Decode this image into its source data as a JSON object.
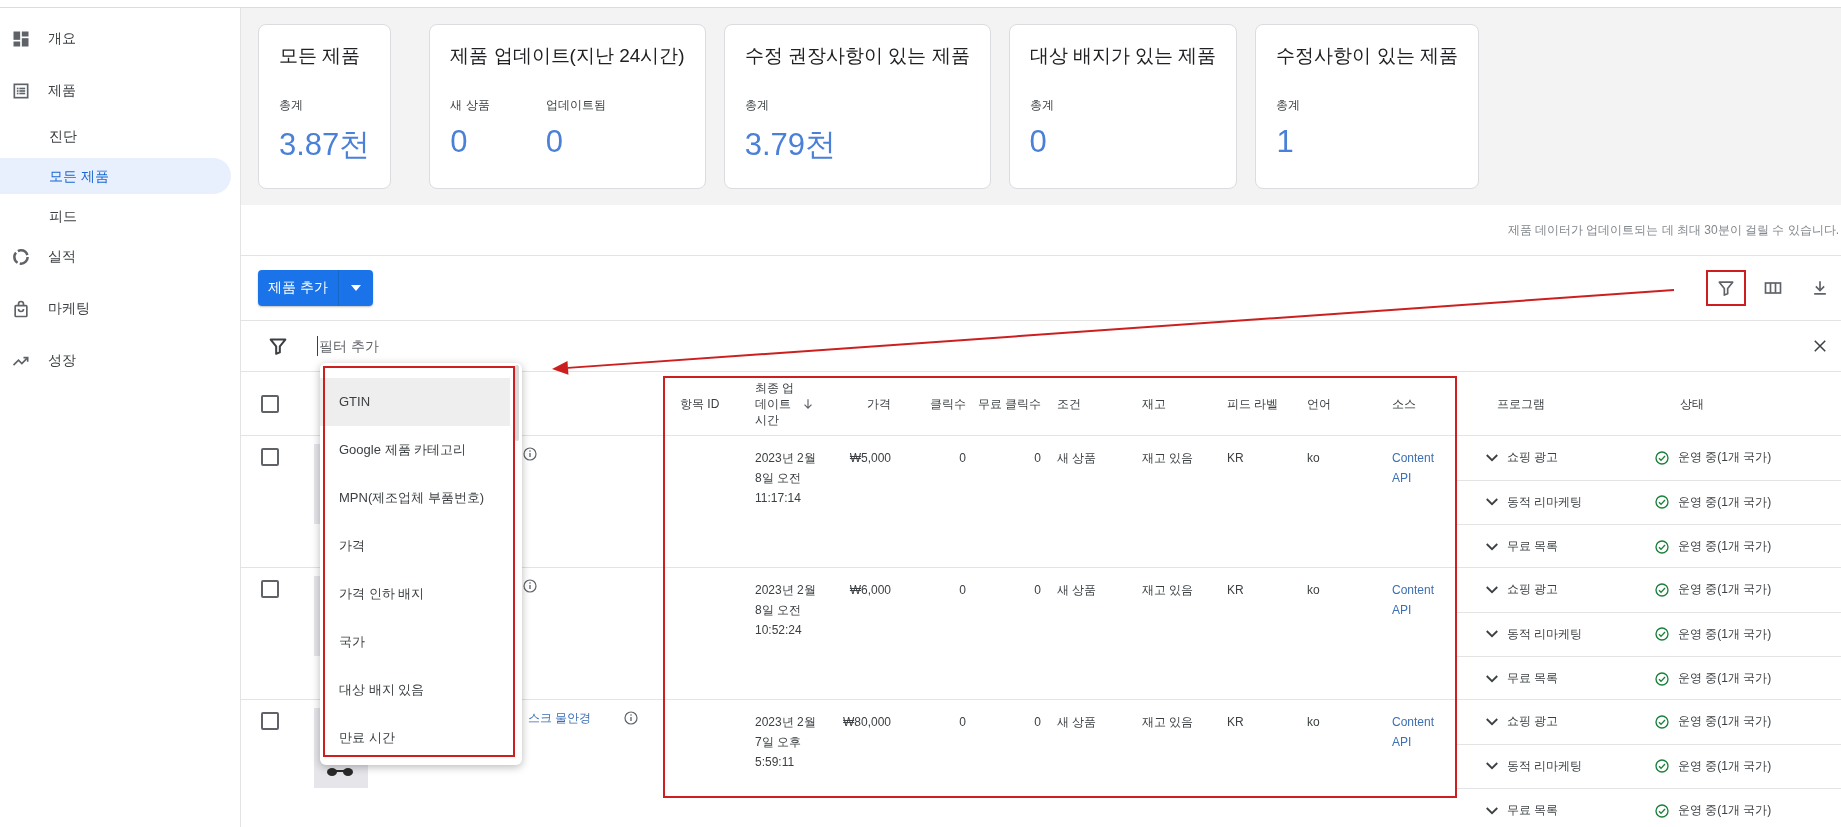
{
  "sidebar": {
    "items": [
      {
        "label": "개요",
        "selected": false
      },
      {
        "label": "제품",
        "selected": false,
        "children": [
          {
            "label": "진단",
            "selected": false
          },
          {
            "label": "모든 제품",
            "selected": true
          },
          {
            "label": "피드",
            "selected": false
          }
        ]
      },
      {
        "label": "실적",
        "selected": false
      },
      {
        "label": "마케팅",
        "selected": false
      },
      {
        "label": "성장",
        "selected": false
      }
    ]
  },
  "summary_cards": [
    {
      "title": "모든 제품",
      "metrics": [
        {
          "label": "총계",
          "value": "3.87천"
        }
      ]
    },
    {
      "title": "제품 업데이트(지난 24시간)",
      "metrics": [
        {
          "label": "새 상품",
          "value": "0"
        },
        {
          "label": "업데이트됨",
          "value": "0"
        }
      ]
    },
    {
      "title": "수정 권장사항이 있는 제품",
      "metrics": [
        {
          "label": "총계",
          "value": "3.79천"
        }
      ]
    },
    {
      "title": "대상 배지가 있는 제품",
      "metrics": [
        {
          "label": "총계",
          "value": "0"
        }
      ]
    },
    {
      "title": "수정사항이 있는 제품",
      "metrics": [
        {
          "label": "총계",
          "value": "1"
        }
      ]
    }
  ],
  "note": "제품 데이터가 업데이트되는 데 최대 30분이 걸릴 수 있습니다.",
  "toolbar": {
    "add_button": "제품 추가"
  },
  "filter_bar": {
    "placeholder": "필터 추가"
  },
  "filter_menu": {
    "items": [
      {
        "label": "GTIN",
        "selected": true
      },
      {
        "label": "Google 제품 카테고리",
        "selected": false
      },
      {
        "label": "MPN(제조업체 부품번호)",
        "selected": false
      },
      {
        "label": "가격",
        "selected": false
      },
      {
        "label": "가격 인하 배지",
        "selected": false
      },
      {
        "label": "국가",
        "selected": false
      },
      {
        "label": "대상 배지 있음",
        "selected": false
      },
      {
        "label": "만료 시간",
        "selected": false
      }
    ]
  },
  "table": {
    "select_all_checked": false,
    "columns": [
      {
        "label": "항목 ID",
        "kind": "text",
        "sorted": false
      },
      {
        "label": "최종 업데이트 시간",
        "kind": "text",
        "sorted": true
      },
      {
        "label": "가격",
        "kind": "number",
        "sorted": false
      },
      {
        "label": "클릭수",
        "kind": "number",
        "sorted": false
      },
      {
        "label": "무료 클릭수",
        "kind": "number",
        "sorted": false
      },
      {
        "label": "조건",
        "kind": "text",
        "sorted": false
      },
      {
        "label": "재고",
        "kind": "text",
        "sorted": false
      },
      {
        "label": "피드 라벨",
        "kind": "text",
        "sorted": false
      },
      {
        "label": "언어",
        "kind": "text",
        "sorted": false
      },
      {
        "label": "소스",
        "kind": "text",
        "sorted": false
      },
      {
        "label": "프로그램",
        "kind": "text",
        "sorted": false
      },
      {
        "label": "상태",
        "kind": "text",
        "sorted": false
      }
    ],
    "rows": [
      {
        "checked": false,
        "updated": "2023년 2월 8일 오전 11:17:14",
        "price": "₩5,000",
        "clicks": "0",
        "free_clicks": "0",
        "condition": "새 상품",
        "availability": "재고 있음",
        "feed_label": "KR",
        "language": "ko",
        "source": "Content API",
        "programs": [
          {
            "name": "쇼핑 광고",
            "status": "운영 중(1개 국가)"
          },
          {
            "name": "동적 리마케팅",
            "status": "운영 중(1개 국가)"
          },
          {
            "name": "무료 목록",
            "status": "운영 중(1개 국가)"
          }
        ]
      },
      {
        "checked": false,
        "updated": "2023년 2월 8일 오전 10:52:24",
        "price": "₩6,000",
        "clicks": "0",
        "free_clicks": "0",
        "condition": "새 상품",
        "availability": "재고 있음",
        "feed_label": "KR",
        "language": "ko",
        "source": "Content API",
        "programs": [
          {
            "name": "쇼핑 광고",
            "status": "운영 중(1개 국가)"
          },
          {
            "name": "동적 리마케팅",
            "status": "운영 중(1개 국가)"
          },
          {
            "name": "무료 목록",
            "status": "운영 중(1개 국가)"
          }
        ]
      },
      {
        "checked": false,
        "title": "스크 물안경",
        "updated": "2023년 2월 7일 오후 5:59:11",
        "price": "₩80,000",
        "clicks": "0",
        "free_clicks": "0",
        "condition": "새 상품",
        "availability": "재고 있음",
        "feed_label": "KR",
        "language": "ko",
        "source": "Content API",
        "programs": [
          {
            "name": "쇼핑 광고",
            "status": "운영 중(1개 국가)"
          },
          {
            "name": "동적 리마케팅",
            "status": "운영 중(1개 국가)"
          },
          {
            "name": "무료 목록",
            "status": "운영 중(1개 국가)"
          }
        ]
      }
    ]
  },
  "annotations": [
    {
      "kind": "frame"
    },
    {
      "kind": "frame"
    },
    {
      "kind": "frame"
    },
    {
      "kind": "arrow"
    }
  ]
}
